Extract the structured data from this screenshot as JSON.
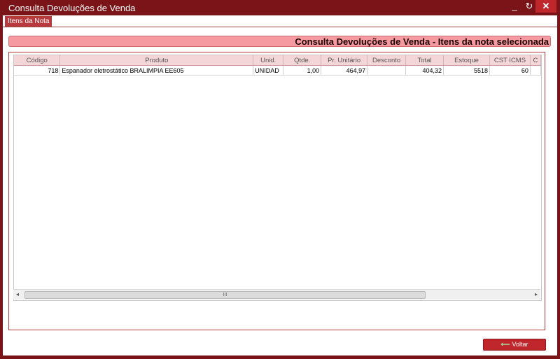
{
  "window": {
    "title": "Consulta Devoluções de Venda",
    "btn_min": "_",
    "btn_refresh": "↻",
    "btn_close": "✕"
  },
  "tabs": [
    {
      "label": "Itens da Nota"
    }
  ],
  "header": {
    "title": "Consulta Devoluções de Venda - Itens da nota selecionada"
  },
  "table": {
    "columns": [
      "Código",
      "Produto",
      "Unid.",
      "Qtde.",
      "Pr. Unitário",
      "Desconto",
      "Total",
      "Estoque",
      "CST ICMS",
      "C"
    ],
    "rows": [
      [
        "718",
        "Espanador eletrostático BRALIMPIA EE605",
        "UNIDAD",
        "1,00",
        "464,97",
        "",
        "404,32",
        "5518",
        "60",
        ""
      ]
    ]
  },
  "scrollbar": {
    "grip": "III",
    "left_arrow": "◂",
    "right_arrow": "▸"
  },
  "footer": {
    "back_label": "Voltar",
    "back_arrow": "⟵"
  },
  "colors": {
    "brand": "#7a1418",
    "accent": "#c0272d",
    "header_bar": "#f59aa0"
  }
}
